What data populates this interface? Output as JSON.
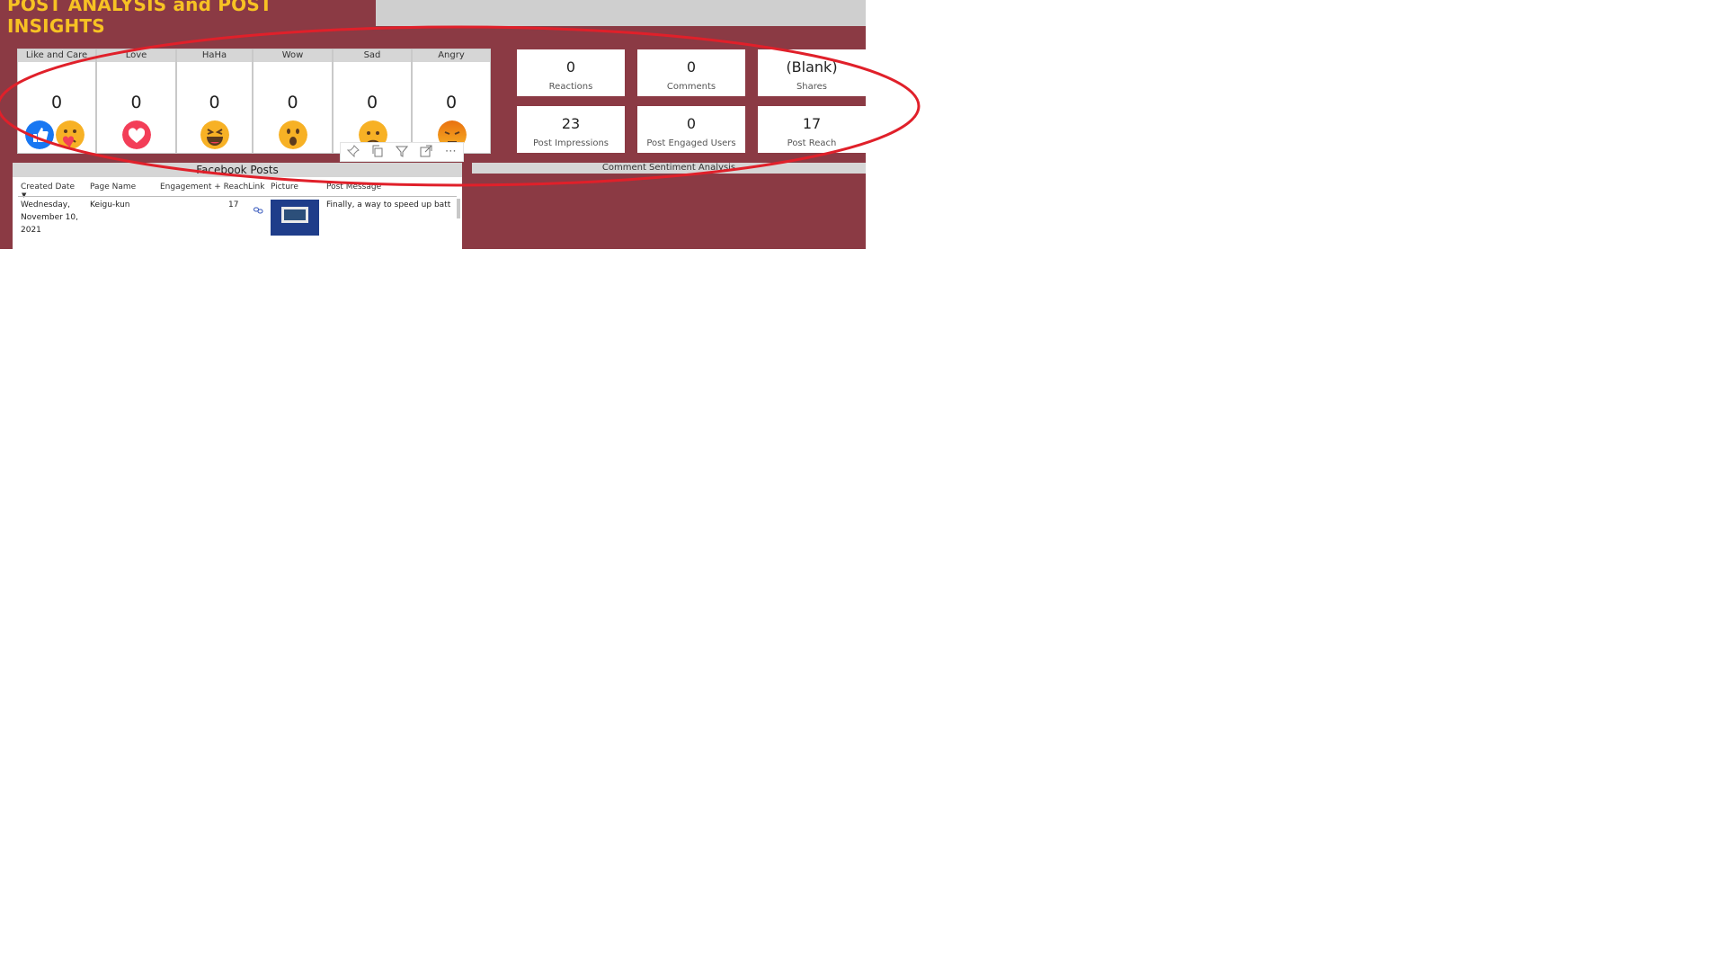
{
  "title": "POST ANALYSIS and POST INSIGHTS",
  "colors": {
    "brand_bg": "#8b3a44",
    "title_text": "#f7c223",
    "annotation": "#e0202a"
  },
  "reactions": [
    {
      "label": "Like and Care",
      "value": "0",
      "icon": "like-care-icon"
    },
    {
      "label": "Love",
      "value": "0",
      "icon": "love-icon"
    },
    {
      "label": "HaHa",
      "value": "0",
      "icon": "haha-icon"
    },
    {
      "label": "Wow",
      "value": "0",
      "icon": "wow-icon"
    },
    {
      "label": "Sad",
      "value": "0",
      "icon": "sad-icon"
    },
    {
      "label": "Angry",
      "value": "0",
      "icon": "angry-icon"
    }
  ],
  "kpis": [
    {
      "value": "0",
      "label": "Reactions"
    },
    {
      "value": "0",
      "label": "Comments"
    },
    {
      "value": "(Blank)",
      "label": "Shares"
    },
    {
      "value": "23",
      "label": "Post Impressions"
    },
    {
      "value": "0",
      "label": "Post Engaged Users"
    },
    {
      "value": "17",
      "label": "Post Reach"
    }
  ],
  "visual_header_icons": [
    "pin-icon",
    "copy-icon",
    "filter-icon",
    "focus-mode-icon",
    "more-options-icon"
  ],
  "facebook_posts": {
    "title": "Facebook Posts",
    "columns": [
      "Created Date",
      "Page Name",
      "Engagement + Reach",
      "Link",
      "Picture",
      "Post Message"
    ],
    "rows": [
      {
        "created_date_lines": [
          "Wednesday,",
          "November 10,",
          "2021"
        ],
        "page_name": "Keigu-kun",
        "engagement_reach": "17",
        "link_icon": "link-icon",
        "post_message": "Finally, a way to speed up batt"
      }
    ]
  },
  "sentiment": {
    "title": "Comment Sentiment Analysis"
  }
}
